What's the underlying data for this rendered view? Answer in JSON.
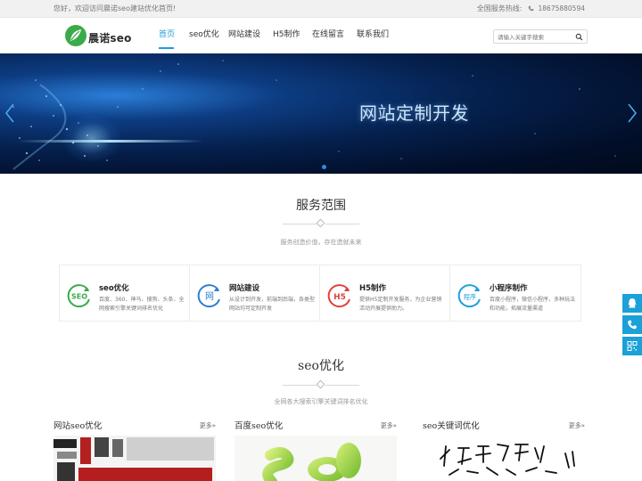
{
  "topbar": {
    "greeting": "您好，欢迎访问晨诺seo建站优化首页!",
    "hotline_label": "全国服务热线:",
    "hotline_number": "18675880594"
  },
  "header": {
    "logo_text": "晨诺seo",
    "nav": [
      {
        "label": "首页",
        "active": true
      },
      {
        "label": "seo优化",
        "active": false
      },
      {
        "label": "网站建设",
        "active": false
      },
      {
        "label": "H5制作",
        "active": false
      },
      {
        "label": "在线留言",
        "active": false
      },
      {
        "label": "联系我们",
        "active": false
      }
    ],
    "search_placeholder": "请输入关键字搜索"
  },
  "banner": {
    "caption": "网站定制开发"
  },
  "services_section": {
    "title": "服务范围",
    "subtitle": "服务创造价值，存在造就未来",
    "items": [
      {
        "icon": "seo-icon",
        "icon_text": "SEO",
        "color": "#3aaa4a",
        "title": "seo优化",
        "desc": "百度、360、神马、搜狗、头条、全网搜索引擎关键词排名优化"
      },
      {
        "icon": "web-icon",
        "icon_text": "网",
        "color": "#2f7fd0",
        "title": "网站建设",
        "desc": "从设计到开发，前端到后端，各类型网站均可定制开发"
      },
      {
        "icon": "h5-icon",
        "icon_text": "H5",
        "color": "#e0413a",
        "title": "H5制作",
        "desc": "提供H5定制开发服务，为企业营销活动开展提供助力。"
      },
      {
        "icon": "miniprogram-icon",
        "icon_text": "程序",
        "color": "#1ba0d8",
        "title": "小程序制作",
        "desc": "百度小程序，微信小程序，多种玩法和功能，拓展流量渠道"
      }
    ]
  },
  "seo_section": {
    "title": "seo优化",
    "subtitle": "全网各大搜索引擎关键词排名优化",
    "columns": [
      {
        "title": "网站seo优化",
        "more": "更多»"
      },
      {
        "title": "百度seo优化",
        "more": "更多»"
      },
      {
        "title": "seo关键词优化",
        "more": "更多»"
      }
    ]
  },
  "colors": {
    "accent": "#1ba0d8",
    "logo_green": "#3aaa4a"
  }
}
